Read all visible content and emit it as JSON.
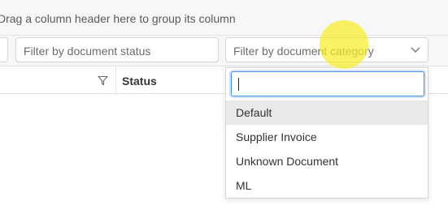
{
  "group_panel": {
    "hint": "Drag a column header here to group its column"
  },
  "filters": {
    "status_placeholder": "Filter by document status",
    "category_placeholder": "Filter by document category"
  },
  "grid_header": {
    "status_label": "Status"
  },
  "dropdown": {
    "search_value": "",
    "options": [
      {
        "label": "Default",
        "selected": true
      },
      {
        "label": "Supplier Invoice",
        "selected": false
      },
      {
        "label": "Unknown Document",
        "selected": false
      },
      {
        "label": "ML",
        "selected": false
      }
    ]
  },
  "icons": {
    "filter": "funnel-icon",
    "dropdown": "chevron-down-icon"
  },
  "colors": {
    "focus_border": "#4a90e2",
    "selected_row": "#e9e9ea",
    "cursor_highlight": "#f6ee28"
  }
}
